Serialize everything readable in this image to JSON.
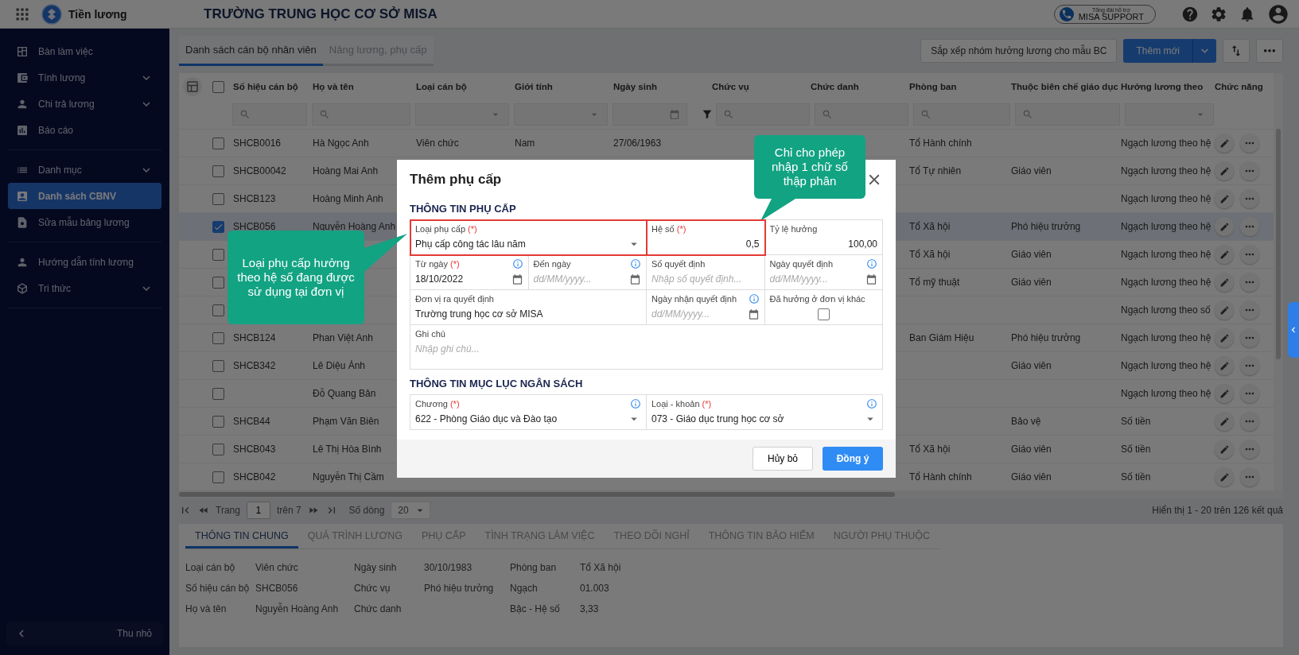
{
  "app": {
    "name": "Tiền lương",
    "organization": "TRƯỜNG TRUNG HỌC CƠ SỞ MISA",
    "support": {
      "caption": "Tổng đài hỗ trợ",
      "label": "MISA SUPPORT"
    }
  },
  "sidebar": {
    "sections": [
      [
        {
          "label": "Bàn làm việc",
          "expandable": false,
          "selected": false
        },
        {
          "label": "Tính lương",
          "expandable": true,
          "selected": false
        },
        {
          "label": "Chi trả lương",
          "expandable": true,
          "selected": false
        },
        {
          "label": "Báo cáo",
          "expandable": false,
          "selected": false
        }
      ],
      [
        {
          "label": "Danh mục",
          "expandable": true,
          "selected": false
        },
        {
          "label": "Danh sách CBNV",
          "expandable": false,
          "selected": true
        },
        {
          "label": "Sửa mẫu bảng lương",
          "expandable": false,
          "selected": false
        }
      ],
      [
        {
          "label": "Hướng dẫn tính lương",
          "expandable": false,
          "selected": false
        },
        {
          "label": "Tri thức",
          "expandable": true,
          "selected": false
        }
      ]
    ],
    "collapse_label": "Thu nhỏ"
  },
  "toolbar": {
    "tabs": [
      {
        "label": "Danh sách cán bộ nhân viên",
        "selected": true
      },
      {
        "label": "Nâng lương, phụ cấp",
        "selected": false
      }
    ],
    "arrange_button": "Sắp xếp nhóm hưởng lương cho mẫu BC",
    "add_button": "Thêm mới"
  },
  "table": {
    "all_checked": false,
    "columns": [
      {
        "label": "Số hiệu cán bộ",
        "kind": "search"
      },
      {
        "label": "Họ và tên",
        "kind": "search"
      },
      {
        "label": "Loại cán bộ",
        "kind": "select"
      },
      {
        "label": "Giới tính",
        "kind": "select"
      },
      {
        "label": "Ngày sinh",
        "kind": "date"
      },
      {
        "label": "Chức vụ",
        "kind": "search"
      },
      {
        "label": "Chức danh",
        "kind": "search"
      },
      {
        "label": "Phòng ban",
        "kind": "search"
      },
      {
        "label": "Thuộc biên chế giáo dục",
        "kind": "search"
      },
      {
        "label": "Hưởng lương theo",
        "kind": "select"
      },
      {
        "label": "Chức năng",
        "kind": "actions"
      }
    ],
    "rows": [
      {
        "checked": false,
        "selected": false,
        "staff_id": "SHCB0016",
        "full_name": "Hà Ngọc Anh",
        "staff_type": "Viên chức",
        "gender": "Nam",
        "birth_date": "27/06/1963",
        "department": "Tổ Hành chính",
        "salary_basis": "Ngạch lương theo hệ"
      },
      {
        "checked": false,
        "selected": false,
        "staff_id": "SHCB00042",
        "full_name": "Hoàng Mai Anh",
        "department": "Tổ Tự nhiên",
        "staffing": "Giáo viên",
        "salary_basis": "Ngạch lương theo hệ"
      },
      {
        "checked": false,
        "selected": false,
        "staff_id": "SHCB123",
        "full_name": "Hoàng Minh Anh",
        "salary_basis": "Ngạch lương theo hệ"
      },
      {
        "checked": true,
        "selected": true,
        "staff_id": "SHCB056",
        "full_name": "Nguyễn Hoàng Anh",
        "department": "Tổ Xã hội",
        "staffing": "Phó hiệu trưởng",
        "salary_basis": "Ngạch lương theo hệ"
      },
      {
        "checked": false,
        "selected": false,
        "department": "Tổ Xã hội",
        "staffing": "Giáo viên",
        "salary_basis": "Ngạch lương theo hệ"
      },
      {
        "checked": false,
        "selected": false,
        "department": "Tổ mỹ thuật",
        "staffing": "Giáo viên",
        "salary_basis": "Ngạch lương theo hệ"
      },
      {
        "checked": false,
        "selected": false,
        "salary_basis": "Ngạch lương theo số"
      },
      {
        "checked": false,
        "selected": false,
        "staff_id": "SHCB124",
        "full_name": "Phan Việt Anh",
        "department": "Ban Giám Hiệu",
        "staffing": "Phó hiệu trưởng",
        "salary_basis": "Ngạch lương theo hệ"
      },
      {
        "checked": false,
        "selected": false,
        "staff_id": "SHCB342",
        "full_name": "Lê Diệu Ánh",
        "staffing": "Giáo viên",
        "salary_basis": "Ngạch lương theo hệ"
      },
      {
        "checked": false,
        "selected": false,
        "full_name": "Đỗ Quang Bản",
        "salary_basis": "Ngạch lương theo hệ"
      },
      {
        "checked": false,
        "selected": false,
        "staff_id": "SHCB44",
        "full_name": "Phạm Văn Biên",
        "staffing": "Bảo vệ",
        "salary_basis": "Số tiền"
      },
      {
        "checked": false,
        "selected": false,
        "staff_id": "SHCB043",
        "full_name": "Lê Thị Hòa Bình",
        "department": "Tổ Xã hội",
        "staffing": "Giáo viên",
        "salary_basis": "Số tiền"
      },
      {
        "checked": false,
        "selected": false,
        "staff_id": "SHCB042",
        "full_name": "Nguyễn Thị Cầm",
        "department": "Tổ Hành chính",
        "staffing": "Giáo viên",
        "salary_basis": "Số tiền"
      }
    ]
  },
  "pagination": {
    "page_label": "Trang",
    "page": "1",
    "of_pages": "trên 7",
    "rows_label": "Số dòng",
    "rows_per_page": "20",
    "summary": "Hiển thị 1 - 20 trên 126 kết quả"
  },
  "detail": {
    "tabs": [
      {
        "label": "THÔNG TIN CHUNG",
        "selected": true
      },
      {
        "label": "QUÁ TRÌNH LƯƠNG",
        "selected": false
      },
      {
        "label": "PHỤ CẤP",
        "selected": false
      },
      {
        "label": "TÌNH TRẠNG LÀM VIỆC",
        "selected": false
      },
      {
        "label": "THEO DÕI NGHỈ",
        "selected": false
      },
      {
        "label": "THÔNG TIN BẢO HIỂM",
        "selected": false
      },
      {
        "label": "NGƯỜI PHỤ THUỘC",
        "selected": false
      }
    ],
    "fields": [
      {
        "label": "Loại cán bộ",
        "value": "Viên chức"
      },
      {
        "label": "Ngày sinh",
        "value": "30/10/1983"
      },
      {
        "label": "Phòng ban",
        "value": "Tổ Xã hội"
      },
      {
        "label": "Số hiệu cán bộ",
        "value": "SHCB056"
      },
      {
        "label": "Chức vụ",
        "value": "Phó hiệu trưởng"
      },
      {
        "label": "Ngạch",
        "value": "01.003"
      },
      {
        "label": "Họ và tên",
        "value": "Nguyễn Hoàng Anh"
      },
      {
        "label": "Chức danh"
      },
      {
        "label": "Bậc - Hệ số",
        "value": "3,33"
      }
    ]
  },
  "dialog": {
    "title": "Thêm phụ cấp",
    "sections": [
      {
        "title": "THÔNG TIN PHỤ CẤP",
        "fields": [
          {
            "kind": "select",
            "label": "Loại phụ cấp",
            "required_mark": "(*)",
            "value": "Phụ cấp công tác lâu năm",
            "info": false,
            "highlight": true
          },
          {
            "kind": "number",
            "label": "Hệ số",
            "required_mark": "(*)",
            "value": "0,5",
            "info": false,
            "highlight": true
          },
          {
            "kind": "number",
            "label": "Tỷ lệ hưởng",
            "value": "100,00",
            "info": false,
            "highlight": false
          },
          {
            "kind": "date",
            "label": "Từ ngày",
            "required_mark": "(*)",
            "value": "18/10/2022",
            "info": true,
            "highlight": false
          },
          {
            "kind": "date",
            "label": "Đến ngày",
            "placeholder": "dd/MM/yyyy...",
            "info": true,
            "highlight": false
          },
          {
            "kind": "input",
            "label": "Số quyết định",
            "placeholder": "Nhập số quyết định...",
            "info": false,
            "highlight": false
          },
          {
            "kind": "date",
            "label": "Ngày quyết định",
            "placeholder": "dd/MM/yyyy...",
            "info": true,
            "highlight": false
          },
          {
            "kind": "entry",
            "label": "Đơn vị ra quyết định",
            "value": "Trường trung học cơ sở MISA",
            "info": false,
            "highlight": false
          },
          {
            "kind": "date",
            "label": "Ngày nhận quyết định",
            "placeholder": "dd/MM/yyyy...",
            "info": true,
            "highlight": false
          },
          {
            "kind": "checkbox",
            "label": "Đã hưởng ở đơn vị khác",
            "checked": false,
            "info": false,
            "highlight": false
          },
          {
            "kind": "textarea",
            "label": "Ghi chú",
            "placeholder": "Nhập ghi chú...",
            "info": false,
            "highlight": false
          }
        ]
      },
      {
        "title": "THÔNG TIN MỤC LỤC NGÂN SÁCH",
        "fields": [
          {
            "kind": "select",
            "label": "Chương",
            "required_mark": "(*)",
            "value": "622 - Phòng Giáo dục và Đào tạo",
            "info": true,
            "highlight": false
          },
          {
            "kind": "select",
            "label": "Loại - khoản",
            "required_mark": "(*)",
            "value": "073 - Giáo dục trung học cơ sở",
            "info": true,
            "highlight": false
          }
        ]
      }
    ],
    "cancel_button": "Hủy bỏ",
    "confirm_button": "Đồng ý"
  },
  "callouts": [
    {
      "text": "Loại phụ cấp hưởng theo hệ số đang được sử dụng tại đơn vị",
      "kind": "right"
    },
    {
      "text": "Chỉ cho phép nhập 1 chữ số thập phân",
      "kind": "down"
    }
  ]
}
